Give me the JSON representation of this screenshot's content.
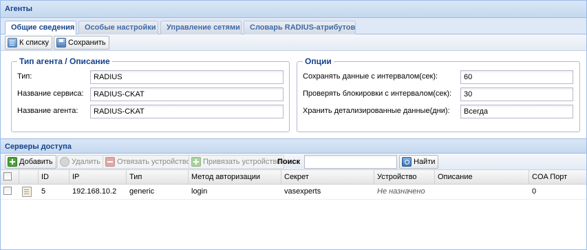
{
  "window": {
    "title": "Агенты"
  },
  "tabs": [
    {
      "label": "Общие сведения",
      "active": true
    },
    {
      "label": "Особые настройки",
      "active": false
    },
    {
      "label": "Управление сетями",
      "active": false
    },
    {
      "label": "Словарь RADIUS-атрибутов",
      "active": false
    }
  ],
  "toolbar": {
    "back_label": "К списку",
    "save_label": "Сохранить"
  },
  "agent_box": {
    "legend": "Тип агента / Описание",
    "type_label": "Тип:",
    "type_value": "RADIUS",
    "service_label": "Название сервиса:",
    "service_value": "RADIUS-CKAT",
    "agent_label": "Название агента:",
    "agent_value": "RADIUS-CKAT"
  },
  "options_box": {
    "legend": "Опции",
    "save_interval_label": "Сохранять данные с интервалом(сек):",
    "save_interval_value": "60",
    "lock_interval_label": "Проверять блокировки с интервалом(сек):",
    "lock_interval_value": "30",
    "detail_label": "Хранить детализированные данные(дни):",
    "detail_value": "Всегда"
  },
  "servers": {
    "title": "Серверы доступа",
    "add_label": "Добавить",
    "delete_label": "Удалить",
    "unbind_label": "Отвязать устройство",
    "bind_label": "Привязать устройство",
    "search_label": "Поиск",
    "search_value": "",
    "find_label": "Найти",
    "columns": {
      "id": "ID",
      "ip": "IP",
      "type": "Тип",
      "auth": "Метод авторизации",
      "secret": "Секрет",
      "device": "Устройство",
      "description": "Описание",
      "coa": "COA Порт"
    },
    "rows": [
      {
        "id": "5",
        "ip": "192.168.10.2",
        "type": "generic",
        "auth": "login",
        "secret": "vasexperts",
        "device": "Не назначено",
        "description": "",
        "coa": "0"
      }
    ]
  },
  "colors": {
    "header_text": "#15428b",
    "header_bg": "#c5d8ef",
    "border": "#99bbe8"
  }
}
